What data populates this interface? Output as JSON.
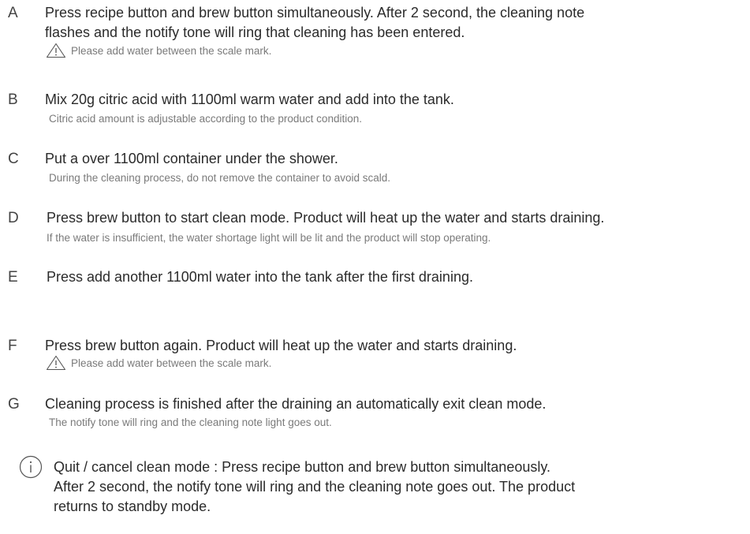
{
  "steps": [
    {
      "letter": "A",
      "lines": [
        "Press recipe button and brew button simultaneously. After 2 second, the cleaning note",
        "flashes and the notify tone will ring that cleaning has been entered."
      ],
      "warning": "Please add water between the scale mark."
    },
    {
      "letter": "B",
      "lines": [
        "Mix 20g citric acid with 1100ml warm water and add into the tank."
      ],
      "note": "Citric acid amount is adjustable according to the product condition."
    },
    {
      "letter": "C",
      "lines": [
        "Put a over 1100ml container under the shower."
      ],
      "note": "During the cleaning process, do not remove the container to avoid scald."
    },
    {
      "letter": "D",
      "lines": [
        "Press brew button to start clean mode. Product will heat up the water and starts draining."
      ],
      "note": "If the water is insufficient, the water shortage light will be lit and the product will stop operating."
    },
    {
      "letter": "E",
      "lines": [
        "Press add another 1100ml water into the tank after the first draining."
      ]
    },
    {
      "letter": "F",
      "lines": [
        "Press brew button again. Product will heat up the water and starts draining."
      ],
      "warning": "Please add water between the scale mark."
    },
    {
      "letter": "G",
      "lines": [
        "Cleaning process is finished after the draining an automatically exit clean mode."
      ],
      "note": "The notify tone will ring and the cleaning note light goes out."
    }
  ],
  "info": {
    "icon": "info-icon",
    "lines": [
      "Quit / cancel clean mode : Press recipe button and brew button simultaneously.",
      "After 2 second, the notify tone will ring and the cleaning note goes out. The product",
      "returns to standby mode."
    ]
  },
  "icons": {
    "warning": "warning-triangle-icon"
  },
  "colors": {
    "main_text": "#2b2b2b",
    "note_text": "#7a7a7a"
  }
}
